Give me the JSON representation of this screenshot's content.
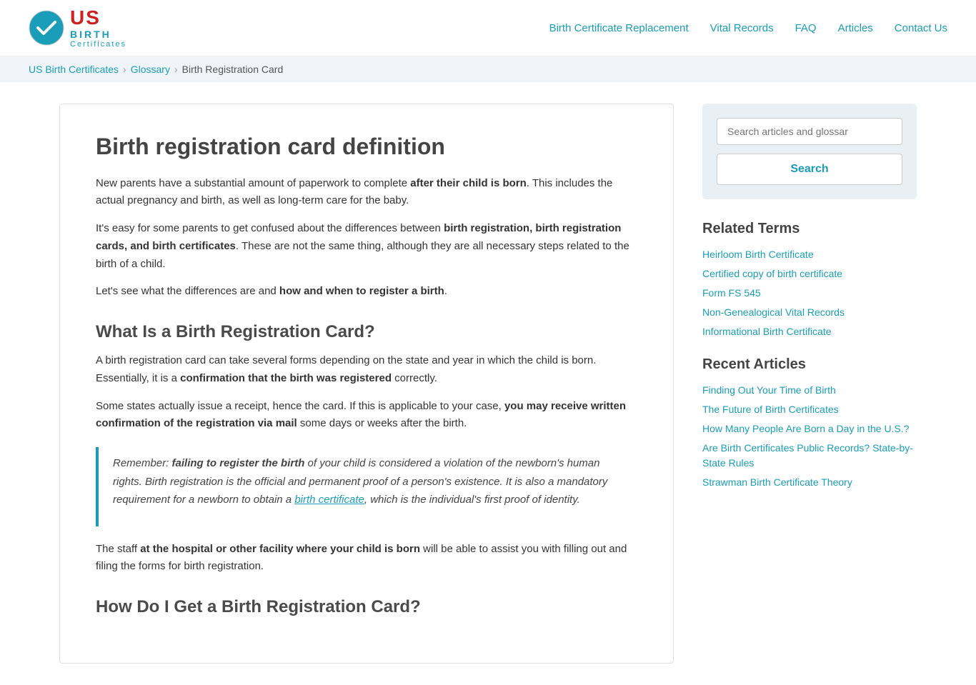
{
  "header": {
    "logo": {
      "us": "US",
      "birth": "BIRTH",
      "certificates": "Certificates"
    },
    "nav": {
      "links": [
        {
          "label": "Birth Certificate Replacement",
          "href": "#"
        },
        {
          "label": "Vital Records",
          "href": "#"
        },
        {
          "label": "FAQ",
          "href": "#"
        },
        {
          "label": "Articles",
          "href": "#"
        },
        {
          "label": "Contact Us",
          "href": "#"
        }
      ]
    }
  },
  "breadcrumb": {
    "items": [
      {
        "label": "US Birth Certificates",
        "href": "#"
      },
      {
        "label": "Glossary",
        "href": "#"
      },
      {
        "label": "Birth Registration Card",
        "href": null
      }
    ]
  },
  "article": {
    "title": "Birth registration card definition",
    "sections": [
      {
        "id": "intro",
        "paragraphs": [
          {
            "text": "New parents have a substantial amount of paperwork to complete ",
            "bold_part": "after their child is born",
            "text_after": ". This includes the actual pregnancy and birth, as well as long-term care for the baby."
          },
          {
            "text": "It’s easy for some parents to get confused about the differences between ",
            "bold_part": "birth registration, birth registration cards, and birth certificates",
            "text_after": ". These are not the same thing, although they are all necessary steps related to the birth of a child."
          },
          {
            "text": "Let’s see what the differences are and ",
            "bold_part": "how and when to register a birth",
            "text_after": "."
          }
        ]
      },
      {
        "id": "what-is",
        "heading": "What Is a Birth Registration Card?",
        "paragraphs": [
          {
            "text": "A birth registration card can take several forms depending on the state and year in which the child is born. Essentially, it is a ",
            "bold_part": "confirmation that the birth was registered",
            "text_after": " correctly."
          },
          {
            "text": "Some states actually issue a receipt, hence the card. If this is applicable to your case, ",
            "bold_part": "you may receive written confirmation of the registration via mail",
            "text_after": " some days or weeks after the birth."
          }
        ],
        "blockquote": {
          "text": "Remember: ",
          "bold_part": "failing to register the birth",
          "text_after": " of your child is considered a violation of the newborn’s human rights. Birth registration is the official and permanent proof of a person’s existence. It is also a mandatory requirement for a newborn to obtain a ",
          "link_text": "birth certificate",
          "link_href": "#",
          "text_end": ", which is the individual’s first proof of identity."
        },
        "after_blockquote": {
          "text": "The staff ",
          "bold_part": "at the hospital or other facility where your child is born",
          "text_after": " will be able to assist you with filling out and filing the forms for birth registration."
        }
      },
      {
        "id": "how-to-get",
        "heading": "How Do I Get a Birth Registration Card?"
      }
    ]
  },
  "sidebar": {
    "search": {
      "placeholder": "Search articles and glossar",
      "button_label": "Search"
    },
    "related_terms": {
      "heading": "Related Terms",
      "links": [
        {
          "label": "Heirloom Birth Certificate",
          "href": "#"
        },
        {
          "label": "Certified copy of birth certificate",
          "href": "#"
        },
        {
          "label": "Form FS 545",
          "href": "#"
        },
        {
          "label": "Non-Genealogical Vital Records",
          "href": "#"
        },
        {
          "label": "Informational Birth Certificate",
          "href": "#"
        }
      ]
    },
    "recent_articles": {
      "heading": "Recent Articles",
      "links": [
        {
          "label": "Finding Out Your Time of Birth",
          "href": "#"
        },
        {
          "label": "The Future of Birth Certificates",
          "href": "#"
        },
        {
          "label": "How Many People Are Born a Day in the U.S.?",
          "href": "#"
        },
        {
          "label": "Are Birth Certificates Public Records? State-by-State Rules",
          "href": "#"
        },
        {
          "label": "Strawman Birth Certificate Theory",
          "href": "#"
        }
      ]
    }
  }
}
